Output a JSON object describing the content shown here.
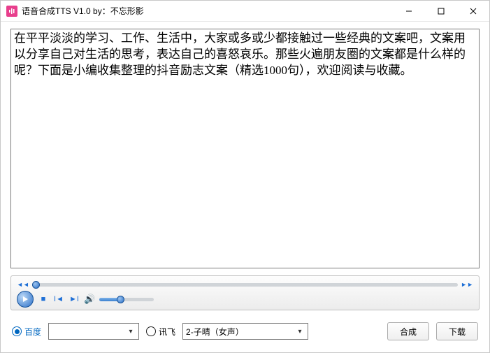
{
  "window": {
    "title": "语音合成TTS V1.0 by：不忘形影"
  },
  "editor": {
    "text": "在平平淡淡的学习、工作、生活中，大家或多或少都接触过一些经典的文案吧，文案用以分享自己对生活的思考，表达自己的喜怒哀乐。那些火遍朋友圈的文案都是什么样的呢？下面是小编收集整理的抖音励志文案（精选1000句），欢迎阅读与收藏。"
  },
  "engines": {
    "baidu": {
      "label": "百度",
      "selected": true,
      "voice": ""
    },
    "xunfei": {
      "label": "讯飞",
      "selected": false,
      "voice": "2-子晴（女声）"
    }
  },
  "buttons": {
    "synthesize": "合成",
    "download": "下载"
  }
}
